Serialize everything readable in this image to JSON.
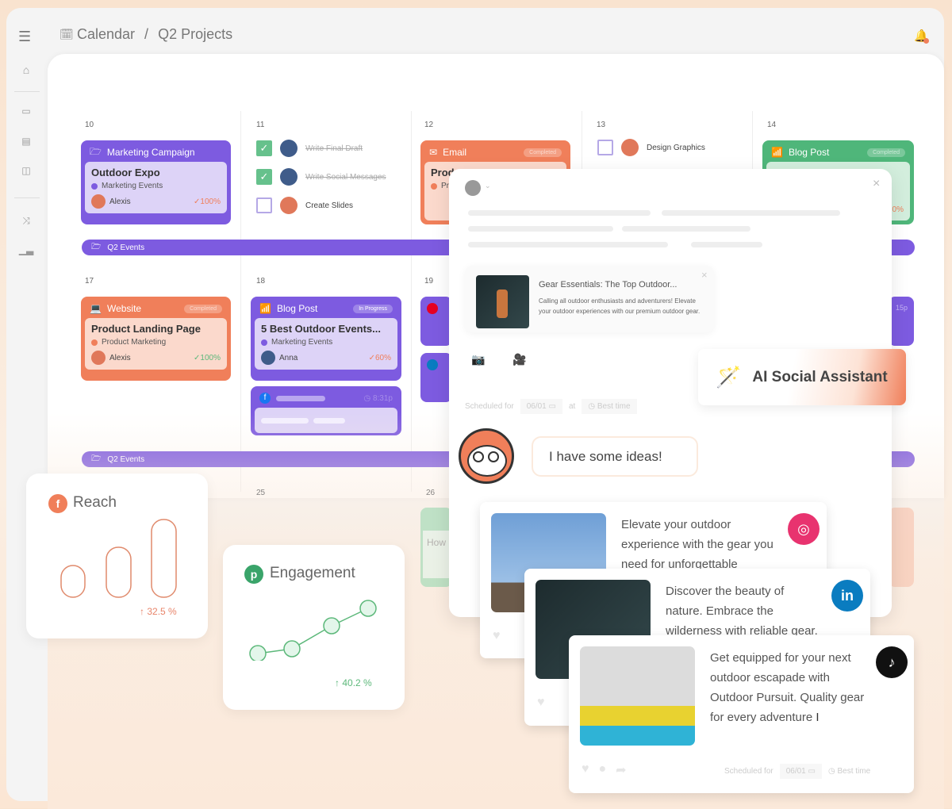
{
  "header": {
    "breadcrumb_root": "Calendar",
    "separator": "/",
    "breadcrumb_current": "Q2 Projects",
    "icons": [
      "menu-icon",
      "calendar-icon",
      "bell-icon"
    ]
  },
  "sidebar": {
    "icons": [
      "home-icon",
      "calendar-icon",
      "layout-icon",
      "columns-icon",
      "shuffle-icon",
      "bar-chart-icon"
    ]
  },
  "calendar": {
    "week1": {
      "dates": [
        "10",
        "11",
        "12",
        "13",
        "14"
      ]
    },
    "week2": {
      "dates": [
        "17",
        "18",
        "19"
      ]
    },
    "week3": {
      "dates": [
        "25",
        "26"
      ]
    },
    "event_bar_label": "Q2 Events",
    "cards": {
      "marketing": {
        "type": "Marketing Campaign",
        "title": "Outdoor Expo",
        "category": "Marketing Events",
        "assignee": "Alexis",
        "progress": "100%"
      },
      "email": {
        "type": "Email",
        "badge": "Completed",
        "title": "Prod",
        "category": "Pr"
      },
      "blog14": {
        "type": "Blog Post",
        "badge": "Completed",
        "progress": "0%"
      },
      "website": {
        "type": "Website",
        "badge": "Completed",
        "title": "Product Landing Page",
        "category": "Product Marketing",
        "assignee": "Alexis",
        "progress": "100%"
      },
      "blog18": {
        "type": "Blog Post",
        "badge": "In Progress",
        "title": "5 Best Outdoor Events...",
        "category": "Marketing Events",
        "assignee": "Anna",
        "progress": "60%"
      },
      "facebook18": {
        "time": "8:31p"
      },
      "right_partial": {
        "time": "15p"
      },
      "row3_partial": {
        "title": "How"
      }
    },
    "tasks11": [
      {
        "label": "Write Final Draft",
        "done": true
      },
      {
        "label": "Write Social Messages",
        "done": true
      },
      {
        "label": "Create Slides",
        "done": false
      }
    ],
    "tasks13": [
      {
        "label": "Design Graphics",
        "done": false
      }
    ]
  },
  "colors": {
    "purple": "#7d5be0",
    "orange": "#f07f5a",
    "green": "#4fb67a",
    "instagram": "#e8336f",
    "linkedin": "#0a7cc0",
    "tiktok": "#111111"
  },
  "composer": {
    "preview": {
      "title": "Gear Essentials: The Top Outdoor...",
      "body": "Calling all outdoor enthusiasts and adventurers! Elevate your outdoor experiences with our premium outdoor gear."
    },
    "scheduled_label": "Scheduled for",
    "date": "06/01",
    "at": "at",
    "time": "Best time"
  },
  "ai": {
    "label": "AI Social Assistant",
    "bubble": "I have some ideas!"
  },
  "posts": [
    {
      "network": "instagram",
      "text": "Elevate your outdoor experience with the gear you need for unforgettable"
    },
    {
      "network": "linkedin",
      "text": "Discover the beauty of nature. Embrace the wilderness with reliable gear."
    },
    {
      "network": "tiktok",
      "text": "Get equipped for your next outdoor escapade with Outdoor Pursuit. Quality gear for every adventure",
      "scheduled_label": "Scheduled for",
      "date": "06/01",
      "time": "Best time"
    }
  ],
  "stats": {
    "reach": {
      "title": "Reach",
      "change": "32.5 %",
      "network": "facebook"
    },
    "engagement": {
      "title": "Engagement",
      "change": "40.2 %",
      "network": "pinterest"
    }
  }
}
